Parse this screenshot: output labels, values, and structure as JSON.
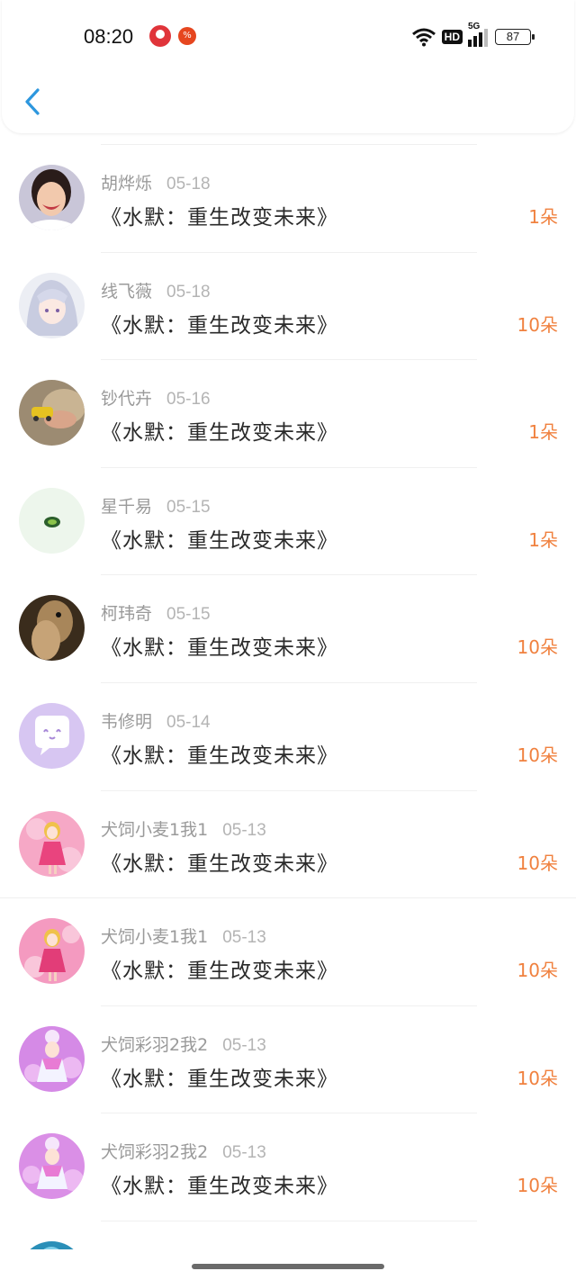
{
  "status_bar": {
    "time": "08:20",
    "network": "5G",
    "hd": "HD",
    "battery": "87"
  },
  "header": {
    "back_icon": "chevron-left-icon",
    "accent_color": "#2d97de"
  },
  "list": {
    "items": [
      {
        "name": "胡烨烁",
        "date": "05-18",
        "book": "《水默：重生改变未来》",
        "count": "1朵"
      },
      {
        "name": "线飞薇",
        "date": "05-18",
        "book": "《水默：重生改变未来》",
        "count": "10朵"
      },
      {
        "name": "钞代卉",
        "date": "05-16",
        "book": "《水默：重生改变未来》",
        "count": "1朵"
      },
      {
        "name": "星千易",
        "date": "05-15",
        "book": "《水默：重生改变未来》",
        "count": "1朵"
      },
      {
        "name": "柯玮奇",
        "date": "05-15",
        "book": "《水默：重生改变未来》",
        "count": "10朵"
      },
      {
        "name": "韦修明",
        "date": "05-14",
        "book": "《水默：重生改变未来》",
        "count": "10朵"
      },
      {
        "name": "犬饲小麦1我1",
        "date": "05-13",
        "book": "《水默：重生改变未来》",
        "count": "10朵"
      },
      {
        "name": "犬饲小麦1我1",
        "date": "05-13",
        "book": "《水默：重生改变未来》",
        "count": "10朵"
      },
      {
        "name": "犬饲彩羽2我2",
        "date": "05-13",
        "book": "《水默：重生改变未来》",
        "count": "10朵"
      },
      {
        "name": "犬饲彩羽2我2",
        "date": "05-13",
        "book": "《水默：重生改变未来》",
        "count": "10朵"
      }
    ],
    "count_color": "#f0813f"
  }
}
